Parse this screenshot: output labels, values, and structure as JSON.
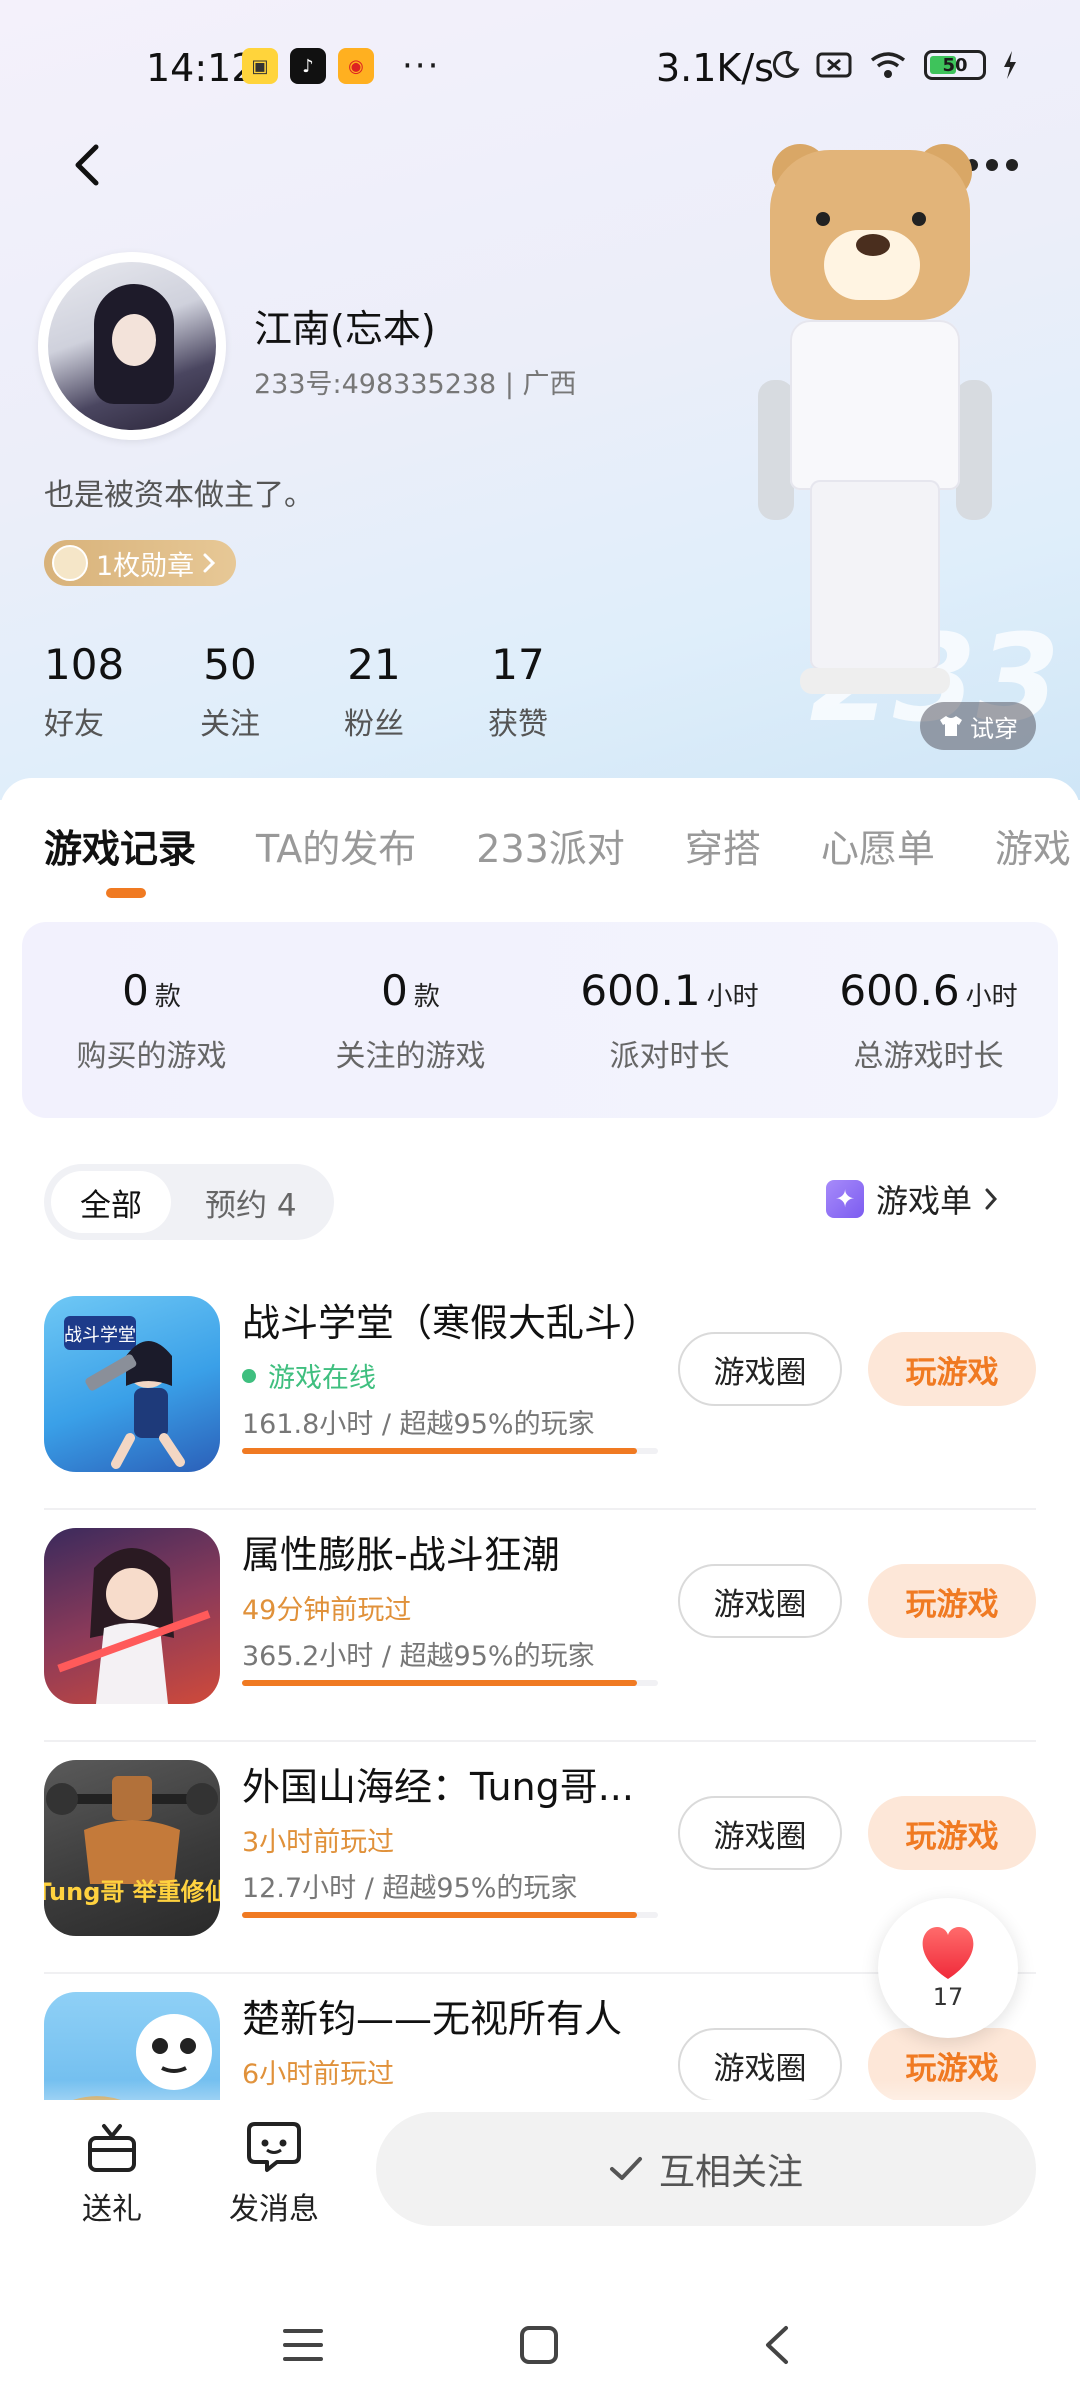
{
  "status_bar": {
    "time": "14:12",
    "network_speed": "3.1K/s",
    "battery": "50",
    "more_dots": "···"
  },
  "profile": {
    "name": "江南(忘本)",
    "id_line": "233号:498335238 | 广西",
    "bio": "也是被资本做主了。",
    "badge": "1枚勋章",
    "stats": [
      {
        "value": "108",
        "label": "好友"
      },
      {
        "value": "50",
        "label": "关注"
      },
      {
        "value": "21",
        "label": "粉丝"
      },
      {
        "value": "17",
        "label": "获赞"
      }
    ],
    "try_on": "试穿",
    "watermark": "233"
  },
  "tabs": [
    "游戏记录",
    "TA的发布",
    "233派对",
    "穿搭",
    "心愿单",
    "游戏"
  ],
  "summary": [
    {
      "value": "0",
      "unit": "款",
      "label": "购买的游戏"
    },
    {
      "value": "0",
      "unit": "款",
      "label": "关注的游戏"
    },
    {
      "value": "600.1",
      "unit": "小时",
      "label": "派对时长"
    },
    {
      "value": "600.6",
      "unit": "小时",
      "label": "总游戏时长"
    }
  ],
  "filter": {
    "all": "全部",
    "reserve": "预约 4",
    "game_list": "游戏单"
  },
  "games": [
    {
      "title": "战斗学堂（寒假大乱斗）",
      "status": "游戏在线",
      "hours": "161.8小时 / 超越95%的玩家",
      "circle": "游戏圈",
      "play": "玩游戏",
      "progress": 0.95,
      "icon_label": "战斗学堂"
    },
    {
      "title": "属性膨胀-战斗狂潮",
      "status": "49分钟前玩过",
      "hours": "365.2小时 / 超越95%的玩家",
      "circle": "游戏圈",
      "play": "玩游戏",
      "progress": 0.95
    },
    {
      "title": "外国山海经：Tung哥...",
      "status": "3小时前玩过",
      "hours": "12.7小时 / 超越95%的玩家",
      "circle": "游戏圈",
      "play": "玩游戏",
      "progress": 0.95,
      "icon_label": "Tung哥 举重修仙"
    },
    {
      "title": "楚新钧——无视所有人",
      "status": "6小时前玩过",
      "circle": "游戏圈",
      "play": "玩游戏"
    }
  ],
  "like": {
    "count": "17"
  },
  "bottom_bar": {
    "gift": "送礼",
    "message": "发消息",
    "follow": "互相关注"
  },
  "colors": {
    "accent": "#f07a22",
    "online": "#3fbf7f",
    "badge_gold": "#d8b27a"
  }
}
